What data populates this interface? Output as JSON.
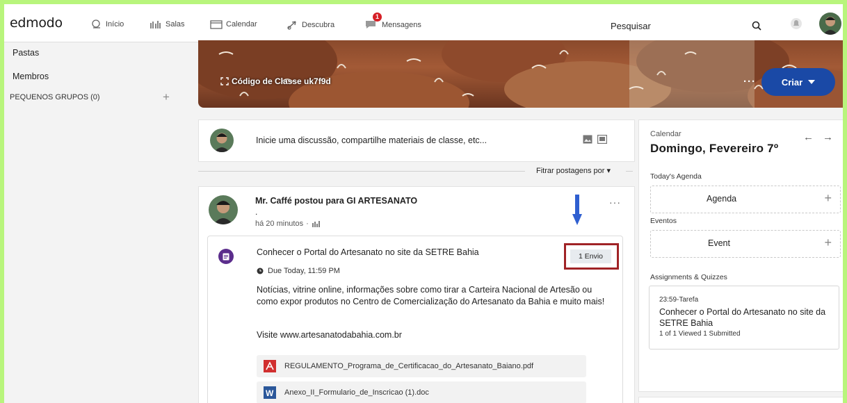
{
  "nav": {
    "logo": "edmodo",
    "items": [
      {
        "label": "Início"
      },
      {
        "label": "Salas"
      },
      {
        "label": "Calendar"
      },
      {
        "label": "Descubra"
      },
      {
        "label": "Mensagens"
      }
    ],
    "messages_badge": "1",
    "search_placeholder": "Pesquisar"
  },
  "sidebar": {
    "folders": "Pastas",
    "members": "Membros",
    "small_groups": "PEQUENOS GRUPOS (0)",
    "add": "+"
  },
  "banner": {
    "class_code": "Código de Classe uk7f9d",
    "more": "···",
    "create_button": "Criar"
  },
  "composer": {
    "prompt": "Inicie uma discussão, compartilhe materiais de classe, etc..."
  },
  "filter": {
    "label": "Fitrar postagens por"
  },
  "post": {
    "author_line": "Mr. Caffé postou para GI ARTESANATO",
    "dot": ".",
    "time": "há 20 minutos",
    "time_sep": "·",
    "menu": "···",
    "assignment": {
      "title": "Conhecer o Portal do Artesanato no site da SETRE Bahia",
      "submissions_button": "1 Envio",
      "due": "Due Today, 11:59 PM",
      "description": "Notícias, vitrine online, informações sobre como tirar a Carteira Nacional de Artesão ou como expor produtos no Centro de Comercialização do Artesanato da Bahia e muito mais!",
      "visit": "Visite www.artesanatodabahia.com.br",
      "attachments": [
        {
          "name": "REGULAMENTO_Programa_de_Certificacao_do_Artesanato_Baiano.pdf",
          "icon": "pdf-icon"
        },
        {
          "name": "Anexo_II_Formulario_de_Inscricao (1).doc",
          "icon": "word-icon"
        }
      ]
    }
  },
  "calendar": {
    "label": "Calendar",
    "date": "Domingo, Fevereiro 7º",
    "agenda_heading": "Today's Agenda",
    "agenda_box": "Agenda",
    "events_heading": "Eventos",
    "event_box": "Event",
    "assignments_heading": "Assignments & Quizzes",
    "assignment_time": "23:59-Tarefa",
    "assignment_title": "Conhecer o Portal do Artesanato no site da SETRE Bahia",
    "assignment_status": "1 of 1 Viewed   1 Submitted"
  },
  "colors": {
    "frame": "#b8f57c",
    "criar_button": "#1a49a6",
    "highlight_box": "#a02326",
    "arrow": "#2f5fd0",
    "assignment_icon": "#5b2d8c",
    "badge": "#d61f26"
  }
}
